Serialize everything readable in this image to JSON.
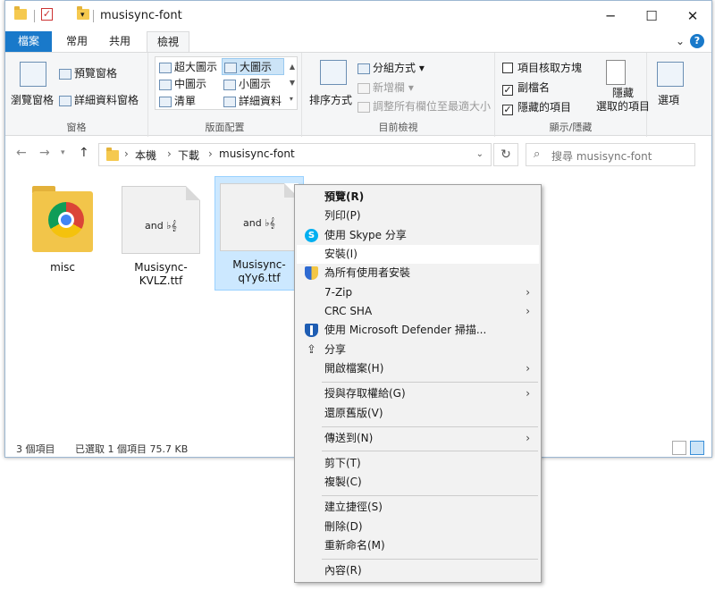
{
  "window": {
    "title": "musisync-font",
    "controls": {
      "minimize": "─",
      "maximize": "☐",
      "close": "✕"
    },
    "quick_access_dropdown": "▾"
  },
  "ribbon_tabs": {
    "file": "檔案",
    "items": [
      "常用",
      "共用",
      "檢視"
    ],
    "active": "檢視",
    "collapse": "⌄",
    "help": "?"
  },
  "ribbon": {
    "pane_group": {
      "label": "窗格",
      "nav_pane": "瀏覽窗格",
      "preview_pane": "預覽窗格",
      "details_pane": "詳細資料窗格"
    },
    "layout_group": {
      "label": "版面配置",
      "items": [
        "超大圖示",
        "大圖示",
        "中圖示",
        "小圖示",
        "清單",
        "詳細資料"
      ],
      "selected": "大圖示"
    },
    "current_view_group": {
      "label": "目前檢視",
      "sort_by": "排序方式",
      "group_by": "分組方式",
      "add_columns": "新增欄",
      "size_all_columns": "調整所有欄位至最適大小"
    },
    "show_hide_group": {
      "label": "顯示/隱藏",
      "checkbox_items": [
        {
          "label": "項目核取方塊",
          "checked": false
        },
        {
          "label": "副檔名",
          "checked": true
        },
        {
          "label": "隱藏的項目",
          "checked": true
        }
      ],
      "hide_selected_line1": "隱藏",
      "hide_selected_line2": "選取的項目",
      "options": "選項"
    }
  },
  "address": {
    "breadcrumb": [
      "本機",
      "下載",
      "musisync-font"
    ],
    "search_placeholder": "搜尋 musisync-font",
    "refresh": "↻"
  },
  "files": [
    {
      "name": "misc",
      "type": "folder"
    },
    {
      "name": "Musisync-KVLZ.ttf",
      "type": "font",
      "sample": "and ♭𝄞"
    },
    {
      "name": "Musisync-qYy6.ttf",
      "type": "font",
      "sample": "and ♭𝄞",
      "selected": true
    }
  ],
  "status": {
    "item_count": "3 個項目",
    "selection": "已選取 1 個項目  75.7 KB"
  },
  "context_menu": {
    "items": [
      {
        "label": "預覽(R)",
        "bold": true
      },
      {
        "label": "列印(P)"
      },
      {
        "label": "使用 Skype 分享",
        "icon": "skype-icon"
      },
      {
        "label": "安裝(I)",
        "hover": true
      },
      {
        "label": "為所有使用者安裝",
        "icon": "uac-shield-icon"
      },
      {
        "label": "7-Zip",
        "submenu": true
      },
      {
        "label": "CRC SHA",
        "submenu": true
      },
      {
        "label": "使用 Microsoft Defender 掃描...",
        "icon": "defender-icon"
      },
      {
        "label": "分享",
        "icon": "share-icon"
      },
      {
        "label": "開啟檔案(H)",
        "submenu": true
      },
      {
        "label": "授與存取權給(G)",
        "submenu": true
      },
      {
        "label": "還原舊版(V)"
      },
      {
        "label": "傳送到(N)",
        "submenu": true
      },
      {
        "label": "剪下(T)"
      },
      {
        "label": "複製(C)"
      },
      {
        "label": "建立捷徑(S)"
      },
      {
        "label": "刪除(D)"
      },
      {
        "label": "重新命名(M)"
      },
      {
        "label": "內容(R)"
      }
    ],
    "submenu_arrow": "›"
  }
}
